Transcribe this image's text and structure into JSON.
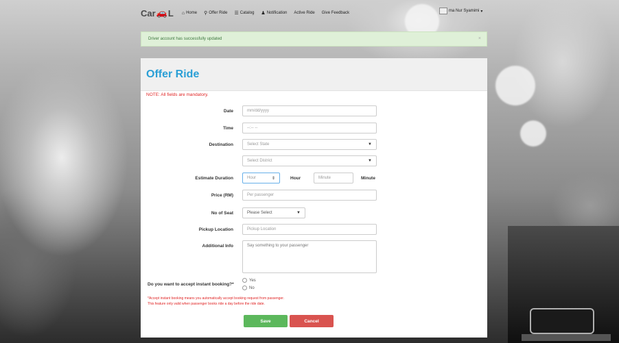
{
  "nav": {
    "logo_prefix": "Car",
    "logo_suffix": "L",
    "items": [
      {
        "icon": "home-icon",
        "glyph": "⌂",
        "label": "Home"
      },
      {
        "icon": "map-marker-icon",
        "glyph": "⚲",
        "label": "Offer Ride"
      },
      {
        "icon": "list-icon",
        "glyph": "☰",
        "label": "Catalog"
      },
      {
        "icon": "bell-icon",
        "glyph": "♟",
        "label": "Notification"
      },
      {
        "icon": "",
        "glyph": "",
        "label": "Active Ride"
      },
      {
        "icon": "",
        "glyph": "",
        "label": "Give Feedback"
      }
    ],
    "user_name": "ma Nur Syamimi",
    "user_caret": "▾"
  },
  "alert": {
    "message": "Driver account has successfully updated",
    "close": "×"
  },
  "form": {
    "title": "Offer Ride",
    "note": "NOTE: All fields are mandatory.",
    "date": {
      "label": "Date",
      "placeholder": "mm/dd/yyyy"
    },
    "time": {
      "label": "Time",
      "placeholder": "--:-- --"
    },
    "destination": {
      "label": "Destination",
      "state": "Select State",
      "district": "Select District"
    },
    "duration": {
      "label": "Estimate Duration",
      "hour_placeholder": "Hour",
      "hour_unit": "Hour",
      "minute_placeholder": "Minute",
      "minute_unit": "Minute"
    },
    "price": {
      "label": "Price (RM)",
      "placeholder": "Per passenger"
    },
    "seat": {
      "label": "No of Seat",
      "value": "Please Select"
    },
    "pickup": {
      "label": "Pickup Location",
      "placeholder": "Pickup Location"
    },
    "info": {
      "label": "Additional Info",
      "placeholder": "Say something to your passenger"
    },
    "instant": {
      "label": "Do you want to accept instant booking?*",
      "yes": "Yes",
      "no": "No"
    },
    "footnote_1": "*Accept instant booking means you automatically accept booking request from passenger.",
    "footnote_2": "This feature only valid when passenger books ride a day before the ride date.",
    "save": "Save",
    "cancel": "Cancel"
  },
  "colors": {
    "accent": "#2a9fd6",
    "success": "#5cb85c",
    "danger": "#d9534f",
    "alert_bg": "#dff0d8"
  }
}
